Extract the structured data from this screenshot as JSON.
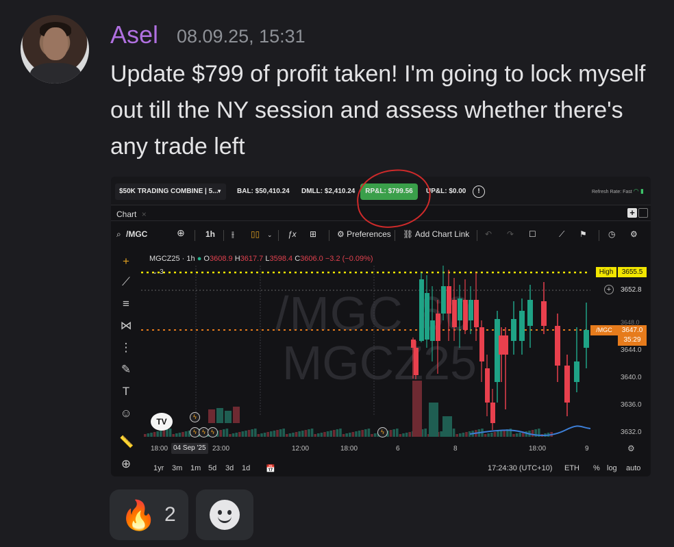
{
  "message": {
    "author": "Asel",
    "timestamp": "08.09.25, 15:31",
    "text": "Update $799 of profit taken! I'm going to lock myself out till the NY session and assess whether there's any trade left"
  },
  "screenshot": {
    "topbar": {
      "account": "$50K TRADING COMBINE | 5...",
      "bal": "BAL: $50,410.24",
      "dmll": "DMLL: $2,410.24",
      "rpl": "RP&L: $799.56",
      "upl": "UP&L: $0.00",
      "alert": "!",
      "refresh": "Refresh Rate: Fast"
    },
    "tab_label": "Chart",
    "toolbar": {
      "symbol": "/MGC",
      "interval": "1h",
      "preferences": "Preferences",
      "chart_link": "Add Chart Link"
    },
    "legend": {
      "symbol": "MGCZ25 · 1h",
      "o_label": "O",
      "o": "3608.9",
      "h_label": "H",
      "h": "3617.7",
      "l_label": "L",
      "l": "3598.4",
      "c_label": "C",
      "c": "3606.0",
      "change": "−3.2 (−0.09%)",
      "collapsed_count": "3"
    },
    "watermark": {
      "line1": "/MGC 60",
      "line2": "MGCZ25"
    },
    "price_axis": {
      "high_label": "High",
      "high_value": "3655.5",
      "crosshair_value": "3652.8",
      "current_label": "/MGC",
      "current_value": "3647.0",
      "countdown": "35:29",
      "ticks": [
        "3648.0",
        "3644.0",
        "3640.0",
        "3636.0",
        "3632.0"
      ]
    },
    "time_axis": {
      "ticks": [
        "18:00",
        "23:00",
        "12:00",
        "18:00",
        "6",
        "8",
        "18:00",
        "9"
      ],
      "selected": "04 Sep '25"
    },
    "bottombar": {
      "ranges": [
        "1yr",
        "3m",
        "1m",
        "5d",
        "3d",
        "1d"
      ],
      "clock": "17:24:30 (UTC+10)",
      "session": "ETH",
      "pct": "%",
      "log": "log",
      "auto": "auto"
    },
    "colors": {
      "up": "#1fa386",
      "down": "#e8404d",
      "high_line": "#f2e600",
      "current_line": "#e67b1c",
      "rpl_bg": "#3a9f4a"
    }
  },
  "reactions": [
    {
      "emoji": "🔥",
      "count": "2"
    }
  ]
}
